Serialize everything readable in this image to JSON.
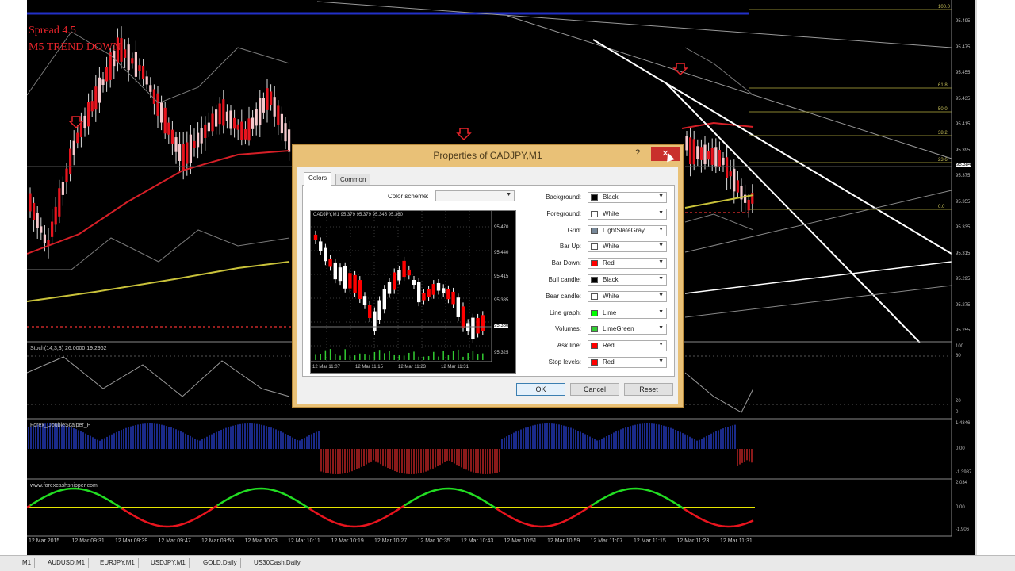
{
  "overlay": {
    "broker_line": "",
    "spread": "Spread 4.5",
    "trend": "M5 TREND DOWN"
  },
  "price_axis": [
    "95.495",
    "95.475",
    "95.455",
    "95.435",
    "95.415",
    "95.395",
    "95.375",
    "95.355",
    "95.335",
    "95.315",
    "95.295",
    "95.275",
    "95.255"
  ],
  "current_price": "95.384",
  "fib_levels": [
    "100.0",
    "61.8",
    "50.0",
    "38.2",
    "23.6",
    "0.0"
  ],
  "stoch": {
    "title": "Stoch(14,3,3) 26.0000 19.2962",
    "axis": [
      "100",
      "80",
      "20",
      "0"
    ]
  },
  "scalper": {
    "title": "Forex_DoubleScalper_P",
    "axis": [
      "1.4346",
      "0.00",
      "-1.3987"
    ]
  },
  "osc": {
    "title": "www.forexcashsnipper.com",
    "axis": [
      "2.034",
      "0.00",
      "-1.906"
    ]
  },
  "time_axis": [
    "12 Mar 2015",
    "12 Mar 09:31",
    "12 Mar 09:39",
    "12 Mar 09:47",
    "12 Mar 09:55",
    "12 Mar 10:03",
    "12 Mar 10:11",
    "12 Mar 10:19",
    "12 Mar 10:27",
    "12 Mar 10:35",
    "12 Mar 10:43",
    "12 Mar 10:51",
    "12 Mar 10:59",
    "12 Mar 11:07",
    "12 Mar 11:15",
    "12 Mar 11:23",
    "12 Mar 11:31"
  ],
  "tabs": [
    "M1",
    "AUDUSD,M1",
    "EURJPY,M1",
    "USDJPY,M1",
    "GOLD,Daily",
    "US30Cash,Daily"
  ],
  "dialog": {
    "title": "Properties of CADJPY,M1",
    "help": "?",
    "close": "✕",
    "tab_colors": "Colors",
    "tab_common": "Common",
    "scheme_label": "Color scheme:",
    "scheme_value": "",
    "preview": {
      "title": "CADJPY,M1  95.379 95.379 95.345 95.360",
      "prices": [
        "95.470",
        "95.440",
        "95.415",
        "95.385",
        "95.360",
        "95.325"
      ],
      "current": "95.360",
      "times": [
        "12 Mar 11:07",
        "12 Mar 11:15",
        "12 Mar 11:23",
        "12 Mar 11:31"
      ]
    },
    "color_rows": [
      {
        "label": "Background:",
        "value": "Black",
        "color": "#000000"
      },
      {
        "label": "Foreground:",
        "value": "White",
        "color": "#ffffff"
      },
      {
        "label": "Grid:",
        "value": "LightSlateGray",
        "color": "#778899"
      },
      {
        "label": "Bar Up:",
        "value": "White",
        "color": "#ffffff"
      },
      {
        "label": "Bar Down:",
        "value": "Red",
        "color": "#ff0000"
      },
      {
        "label": "Bull candle:",
        "value": "Black",
        "color": "#000000"
      },
      {
        "label": "Bear candle:",
        "value": "White",
        "color": "#ffffff"
      },
      {
        "label": "Line graph:",
        "value": "Lime",
        "color": "#00ff00"
      },
      {
        "label": "Volumes:",
        "value": "LimeGreen",
        "color": "#32cd32"
      },
      {
        "label": "Ask line:",
        "value": "Red",
        "color": "#ff0000"
      },
      {
        "label": "Stop levels:",
        "value": "Red",
        "color": "#ff0000"
      }
    ],
    "btn_ok": "OK",
    "btn_cancel": "Cancel",
    "btn_reset": "Reset"
  }
}
